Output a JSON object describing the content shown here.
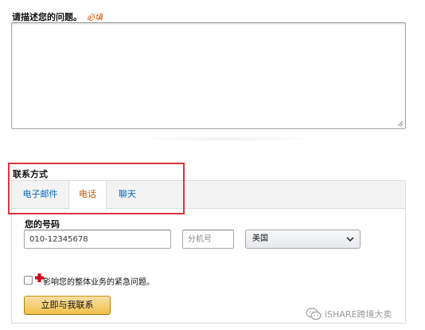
{
  "question": {
    "label": "请描述您的问题。",
    "required": "必填"
  },
  "contact": {
    "label": "联系方式",
    "tabs": [
      {
        "label": "电子邮件",
        "active": false
      },
      {
        "label": "电话",
        "active": true
      },
      {
        "label": "聊天",
        "active": false
      }
    ]
  },
  "phone_form": {
    "number_label": "您的号码",
    "number_value": "010-12345678",
    "extension_placeholder": "分机号",
    "country_selected": "美国",
    "urgent_label": "影响您的整体业务的紧急问题。",
    "urgent_checked": false,
    "submit_label": "立即与我联系"
  },
  "watermark": {
    "text": "iSHARE跨境大卖"
  },
  "colors": {
    "highlight": "#d9363e",
    "link": "#0066c0",
    "active_tab": "#c45500",
    "button": "#f0c14b",
    "required": "#c45500"
  }
}
